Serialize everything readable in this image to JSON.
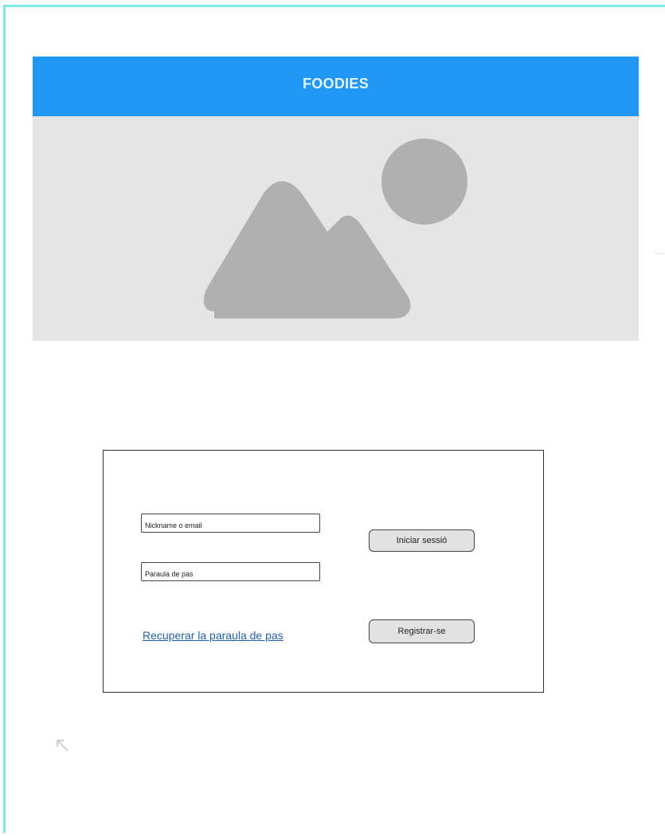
{
  "app": {
    "title": "FOODIES"
  },
  "hero": {
    "icon": "image-placeholder-icon",
    "colors": {
      "background": "#e5e5e5",
      "shape": "#b0b0b0"
    }
  },
  "login": {
    "username_placeholder": "Nickname o email",
    "password_placeholder": "Paraula de pas",
    "login_button": "Iniciar sessió",
    "register_button": "Registrar-se",
    "recover_link": "Recuperar la paraula de pas"
  },
  "colors": {
    "header": "#2196f3",
    "header_text": "#dff3ff",
    "frame_border": "#7fe6ea",
    "link": "#2460a8",
    "button_bg": "#e2e2e2"
  },
  "icons": {
    "resize": "resize-arrow-icon"
  }
}
